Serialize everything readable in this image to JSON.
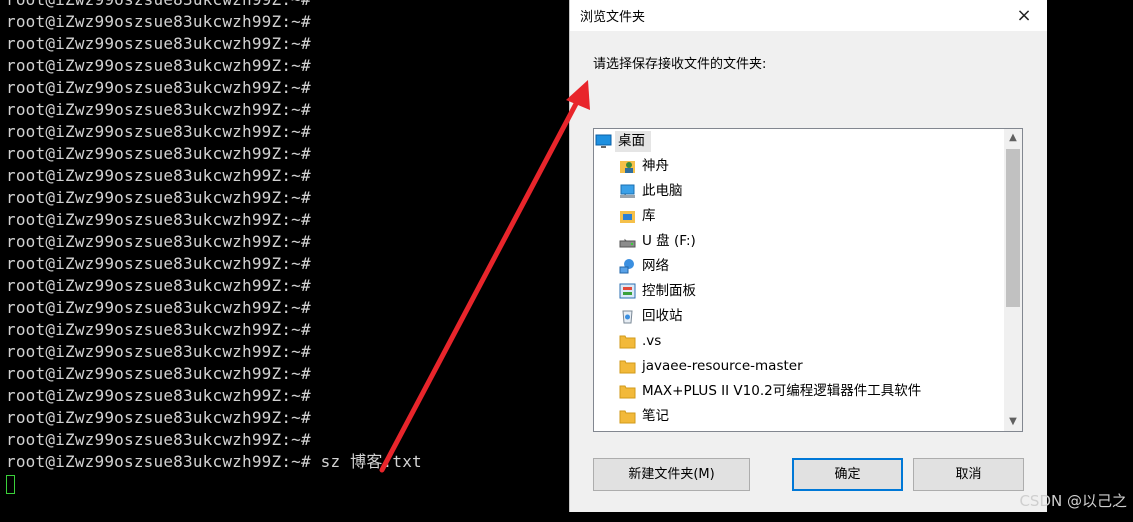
{
  "terminal": {
    "prompt": "root@iZwz99oszsue83ukcwzh99Z:~#",
    "repeated_prompt_count": 21,
    "last_command": " sz 博客.txt"
  },
  "dialog": {
    "title": "浏览文件夹",
    "close_icon": "×",
    "prompt_text": "请选择保存接收文件的文件夹:",
    "tree_items": [
      {
        "label": "桌面",
        "icon": "desktop-icon",
        "expandable": false,
        "indent": 0,
        "selected": true
      },
      {
        "label": "神舟",
        "icon": "user-folder-icon",
        "expandable": true,
        "indent": 1,
        "selected": false
      },
      {
        "label": "此电脑",
        "icon": "computer-icon",
        "expandable": true,
        "indent": 1,
        "selected": false
      },
      {
        "label": "库",
        "icon": "library-icon",
        "expandable": true,
        "indent": 1,
        "selected": false
      },
      {
        "label": "U 盘 (F:)",
        "icon": "usb-drive-icon",
        "expandable": true,
        "indent": 1,
        "selected": false
      },
      {
        "label": "网络",
        "icon": "network-icon",
        "expandable": true,
        "indent": 1,
        "selected": false
      },
      {
        "label": "控制面板",
        "icon": "control-panel-icon",
        "expandable": true,
        "indent": 1,
        "selected": false
      },
      {
        "label": "回收站",
        "icon": "recycle-bin-icon",
        "expandable": false,
        "indent": 1,
        "selected": false
      },
      {
        "label": ".vs",
        "icon": "folder-icon",
        "expandable": true,
        "indent": 1,
        "selected": false
      },
      {
        "label": "javaee-resource-master",
        "icon": "folder-icon",
        "expandable": true,
        "indent": 1,
        "selected": false
      },
      {
        "label": "MAX+PLUS II V10.2可编程逻辑器件工具软件",
        "icon": "folder-icon",
        "expandable": false,
        "indent": 1,
        "selected": false
      },
      {
        "label": "笔记",
        "icon": "folder-icon",
        "expandable": true,
        "indent": 1,
        "selected": false
      }
    ],
    "buttons": {
      "new_folder": "新建文件夹(M)",
      "ok": "确定",
      "cancel": "取消"
    }
  },
  "watermark": "CSDN @以己之",
  "colors": {
    "terminal_text": "#d2d2d2",
    "cursor": "#3ad13a",
    "arrow": "#e8252b",
    "focus_border": "#0078d7"
  }
}
